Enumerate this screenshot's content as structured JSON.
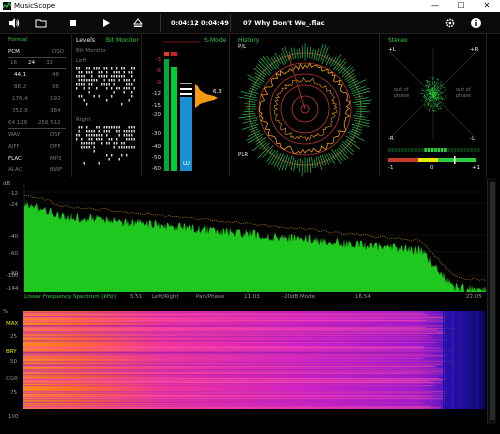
{
  "window": {
    "title": "MusicScope",
    "minimize": "—",
    "maximize": "☐",
    "close": "✕"
  },
  "toolbar": {
    "elapsed": "0:04:12",
    "separator": "/",
    "total": "0:04:49",
    "track_title": "07 Why Don't We_.flac"
  },
  "format": {
    "title": "Format",
    "pcm": "PCM",
    "dsd": "DSD",
    "bits": [
      "16",
      "24",
      "32"
    ],
    "rates_left": [
      "44.1",
      "88.2",
      "176.4",
      "352.8",
      "64 128",
      "DSF",
      "FLAC",
      "ALAC"
    ],
    "rates_right": [
      "48",
      "96",
      "192",
      "384",
      "256 512",
      "DSF",
      "MP3",
      "BWF"
    ],
    "containers_left": [
      "WAV",
      "AIFF"
    ],
    "containers_right": [
      "DSF",
      "DFF"
    ]
  },
  "levels": {
    "title": "Levels",
    "bit_monitor": "Bit Monitor",
    "bit_monitor_sub": "Bit Monitor",
    "left": "Left",
    "right": "Right"
  },
  "meter": {
    "s_mode": "S-Mode",
    "scale": [
      "-3",
      "-6",
      "-9",
      "-12",
      "-15",
      "-20",
      "-30",
      "-40",
      "-50",
      "-60"
    ],
    "value": "6.3",
    "lu": "LU"
  },
  "history": {
    "title": "History",
    "pl": "P/L",
    "plr": "PLR"
  },
  "stereo": {
    "title": "Stereo",
    "plus_l": "+L",
    "plus_r": "+R",
    "minus_l": "-L",
    "minus_r": "-R",
    "out_of_phase": "out of phase",
    "corr_left": "-1",
    "corr_mid": "0",
    "corr_right": "+1"
  },
  "spectrum": {
    "title": "Linear Frequency Spectrum [kHz]",
    "db_label": "dB",
    "y_ticks": [
      "-12",
      "-24",
      "-40",
      "-60",
      "-80",
      "-100",
      "-144"
    ],
    "x_ticks": [
      "5.51",
      "11.03",
      "16.54",
      "22.05"
    ],
    "modes": [
      "Left/Right",
      "Pan/Phase",
      "-20dB Mode"
    ]
  },
  "spectrogram": {
    "pct": "%",
    "y_ticks": [
      "25",
      "50",
      "75",
      "100"
    ],
    "labels": [
      "MAX",
      "BRY",
      "CGR"
    ]
  }
}
